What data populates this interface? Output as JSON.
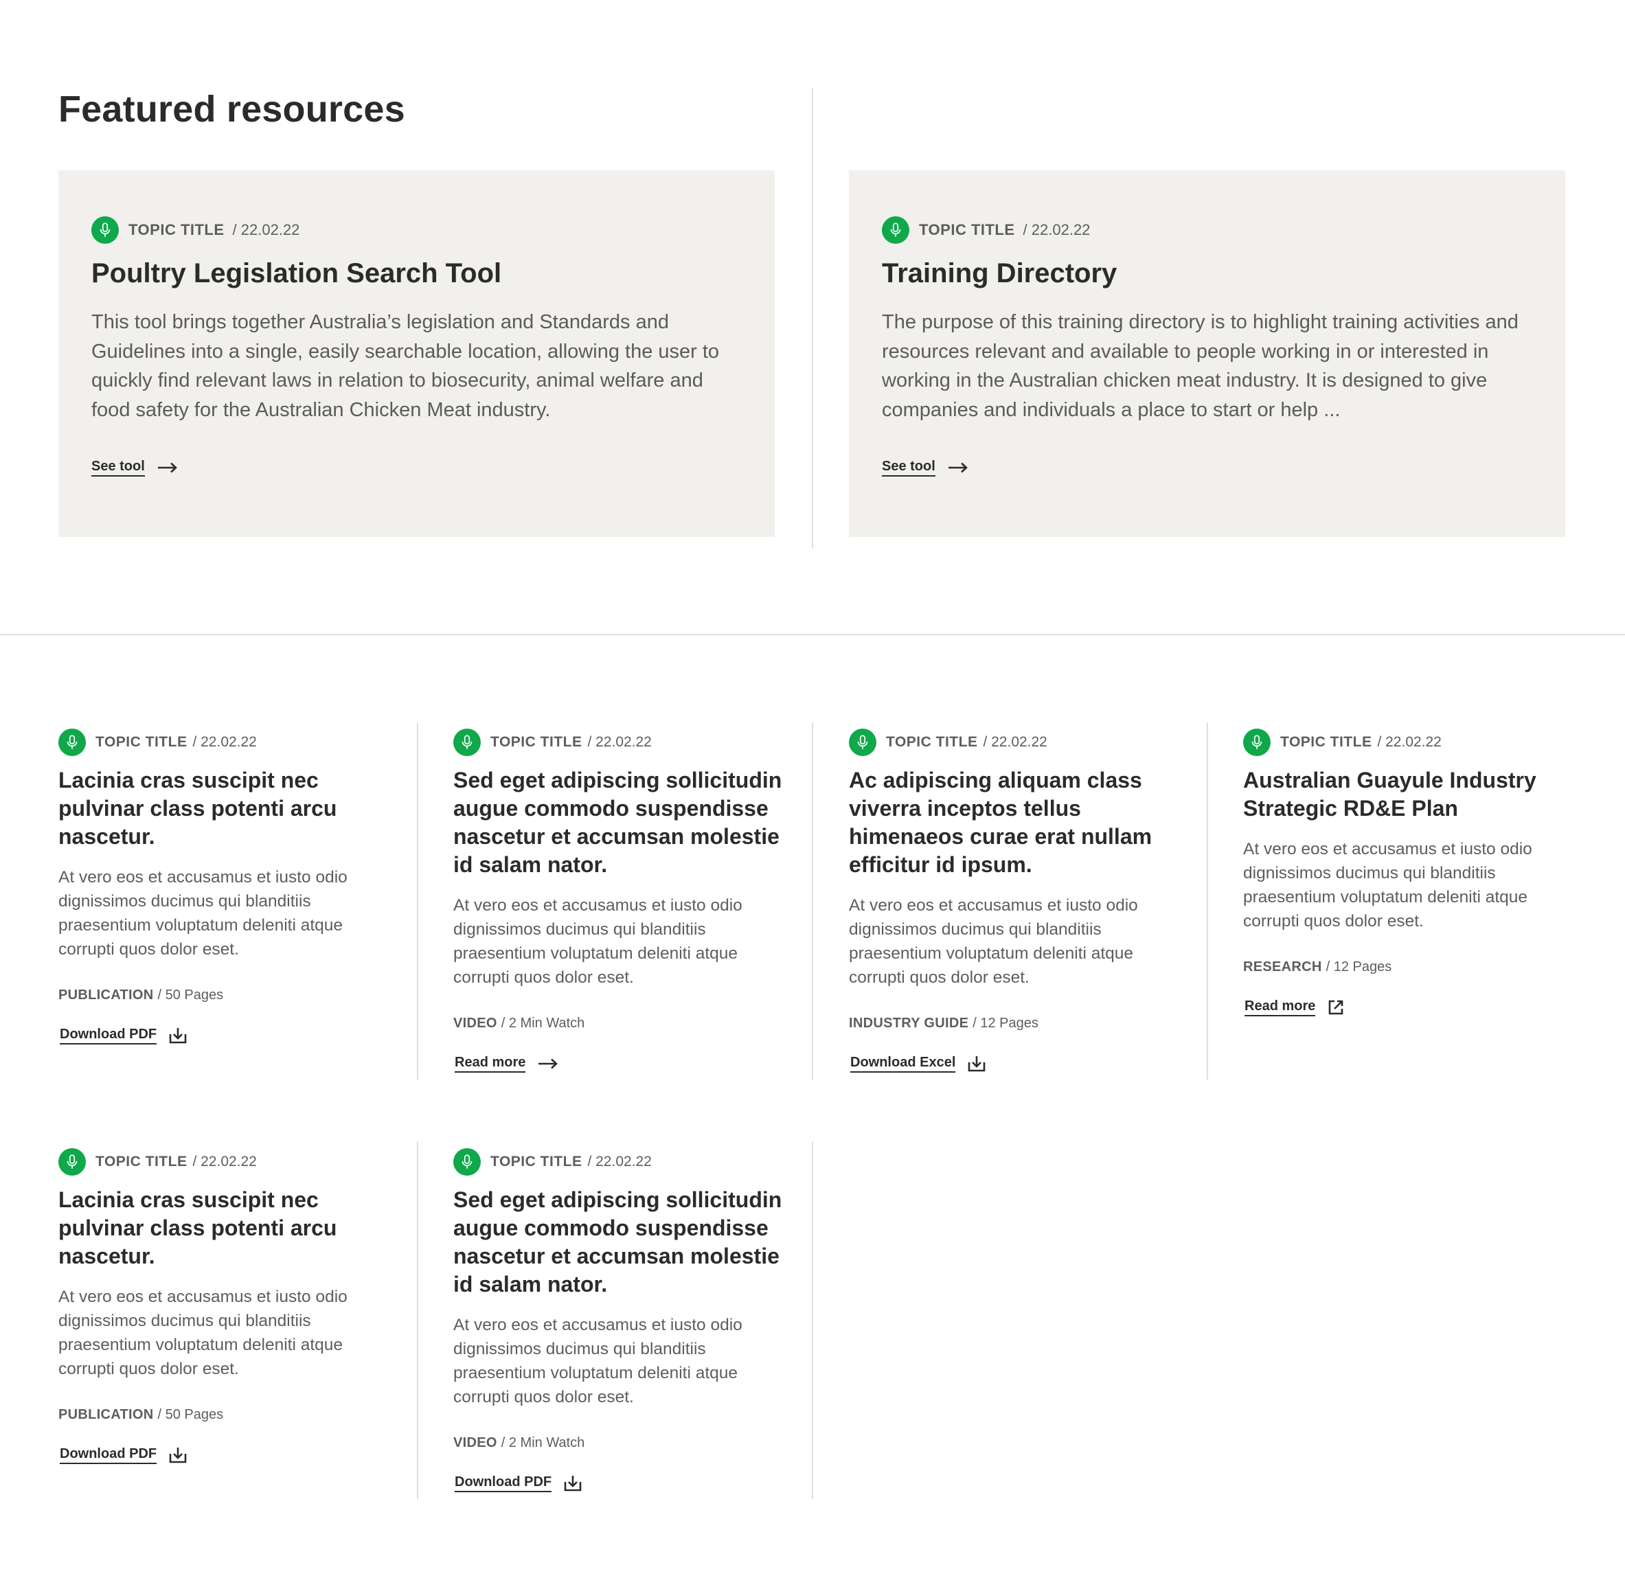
{
  "page": {
    "title": "Featured resources"
  },
  "colors": {
    "accent": "#0fa84a",
    "card_bg": "#f1f0ec",
    "text": "#2b2b2b",
    "muted": "#5d5d5d"
  },
  "featured": [
    {
      "topic": "TOPIC TITLE",
      "date": "/ 22.02.22",
      "title": "Poultry Legislation Search Tool",
      "description": "This tool brings together Australia’s legislation and Standards and Guidelines into a single, easily searchable location, allowing the user to quickly find relevant laws in relation to biosecurity, animal welfare and food safety for the Australian Chicken Meat industry.",
      "cta": "See tool",
      "cta_icon": "arrow-right-icon"
    },
    {
      "topic": "TOPIC TITLE",
      "date": "/ 22.02.22",
      "title": "Training Directory",
      "description": "The purpose of this training directory is to highlight training activities and resources relevant and available to people working in or interested in working in the Australian chicken meat industry. It is designed to give companies and individuals a place to start or help ...",
      "cta": "See tool",
      "cta_icon": "arrow-right-icon"
    }
  ],
  "cards": [
    {
      "topic": "TOPIC TITLE",
      "date": "/ 22.02.22",
      "title": "Lacinia cras suscipit nec pulvinar class potenti arcu nascetur.",
      "description": "At vero eos et accusamus et iusto odio dignissimos ducimus qui blanditiis praesentium voluptatum deleniti atque corrupti quos dolor eset.",
      "type": "PUBLICATION",
      "pages": "/ 50 Pages",
      "cta": "Download PDF",
      "cta_icon": "download-icon"
    },
    {
      "topic": "TOPIC TITLE",
      "date": "/ 22.02.22",
      "title": "Sed eget adipiscing sollicitudin augue commodo suspendisse nascetur et accumsan molestie id salam nator.",
      "description": "At vero eos et accusamus et iusto odio dignissimos ducimus qui blanditiis praesentium voluptatum deleniti atque corrupti quos dolor eset.",
      "type": "VIDEO",
      "pages": "/ 2 Min Watch",
      "cta": "Read more",
      "cta_icon": "arrow-right-icon"
    },
    {
      "topic": "TOPIC TITLE",
      "date": "/ 22.02.22",
      "title": "Ac adipiscing aliquam class viverra inceptos tellus himenaeos curae erat nullam efficitur id ipsum.",
      "description": "At vero eos et accusamus et iusto odio dignissimos ducimus qui blanditiis praesentium voluptatum deleniti atque corrupti quos dolor eset.",
      "type": "INDUSTRY GUIDE",
      "pages": "/ 12 Pages",
      "cta": "Download Excel",
      "cta_icon": "download-icon"
    },
    {
      "topic": "TOPIC TITLE",
      "date": "/ 22.02.22",
      "title": "Australian Guayule Industry Strategic RD&E Plan",
      "description": "At vero eos et accusamus et iusto odio dignissimos ducimus qui blanditiis praesentium voluptatum deleniti atque corrupti quos dolor eset.",
      "type": "RESEARCH",
      "pages": "/ 12 Pages",
      "cta": "Read more",
      "cta_icon": "external-link-icon"
    },
    {
      "topic": "TOPIC TITLE",
      "date": "/ 22.02.22",
      "title": "Lacinia cras suscipit nec pulvinar class potenti arcu nascetur.",
      "description": "At vero eos et accusamus et iusto odio dignissimos ducimus qui blanditiis praesentium voluptatum deleniti atque corrupti quos dolor eset.",
      "type": "PUBLICATION",
      "pages": "/ 50 Pages",
      "cta": "Download PDF",
      "cta_icon": "download-icon"
    },
    {
      "topic": "TOPIC TITLE",
      "date": "/ 22.02.22",
      "title": "Sed eget adipiscing sollicitudin augue commodo suspendisse nascetur et accumsan molestie id salam nator.",
      "description": "At vero eos et accusamus et iusto odio dignissimos ducimus qui blanditiis praesentium voluptatum deleniti atque corrupti quos dolor eset.",
      "type": "VIDEO",
      "pages": "/ 2 Min Watch",
      "cta": "Download PDF",
      "cta_icon": "download-icon"
    }
  ]
}
